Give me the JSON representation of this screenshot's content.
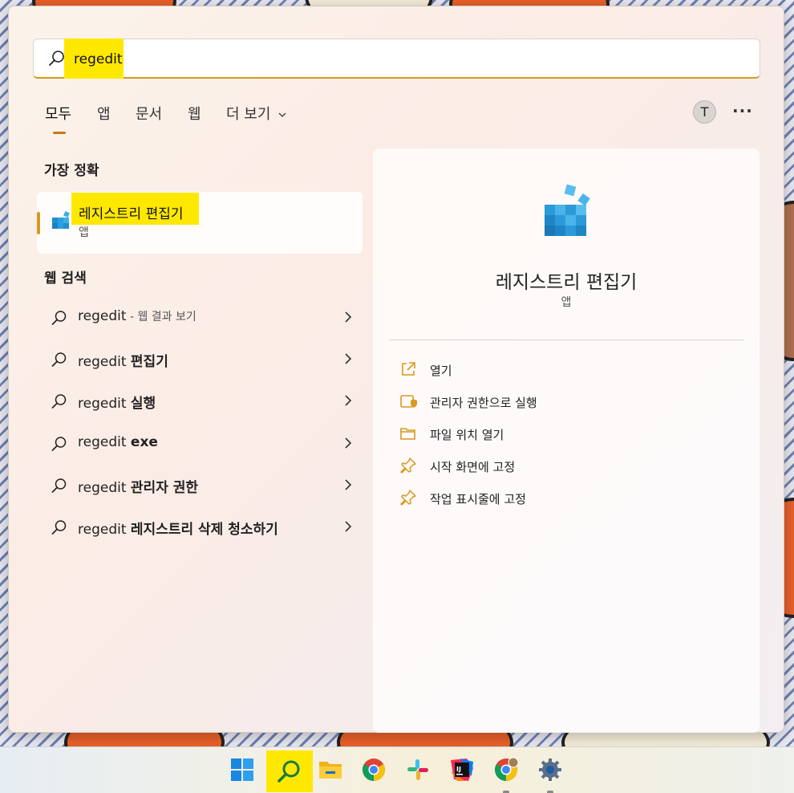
{
  "search": {
    "value": "regedit"
  },
  "tabs": [
    {
      "label": "모두"
    },
    {
      "label": "앱"
    },
    {
      "label": "문서"
    },
    {
      "label": "웹"
    },
    {
      "label": "더 보기"
    }
  ],
  "account": {
    "initial": "T"
  },
  "more_options": "···",
  "best_match": {
    "section_title": "가장 정확",
    "name": "레지스트리 편집기",
    "type": "앱"
  },
  "web_search": {
    "section_title": "웹 검색",
    "items": [
      {
        "query": "regedit",
        "bold": "",
        "suffix": " - 웹 결과 보기"
      },
      {
        "query": "regedit ",
        "bold": "편집기",
        "suffix": ""
      },
      {
        "query": "regedit ",
        "bold": "실행",
        "suffix": ""
      },
      {
        "query": "regedit ",
        "bold": "exe",
        "suffix": ""
      },
      {
        "query": "regedit ",
        "bold": "관리자 권한",
        "suffix": ""
      },
      {
        "query": "regedit ",
        "bold": "레지스트리 삭제 청소하기",
        "suffix": ""
      }
    ]
  },
  "detail": {
    "title": "레지스트리 편집기",
    "type": "앱",
    "actions": [
      {
        "label": "열기",
        "icon": "open-external-icon"
      },
      {
        "label": "관리자 권한으로 실행",
        "icon": "admin-shield-icon"
      },
      {
        "label": "파일 위치 열기",
        "icon": "folder-icon"
      },
      {
        "label": "시작 화면에 고정",
        "icon": "pin-icon"
      },
      {
        "label": "작업 표시줄에 고정",
        "icon": "pin-icon"
      }
    ]
  },
  "taskbar": {
    "items": [
      "windows-start-icon",
      "search-icon",
      "file-explorer-icon",
      "chrome-icon",
      "slack-icon",
      "intellij-icon",
      "chrome-profile-icon",
      "settings-icon"
    ]
  },
  "colors": {
    "accent": "#d89a1e",
    "highlight": "#ffe800"
  }
}
